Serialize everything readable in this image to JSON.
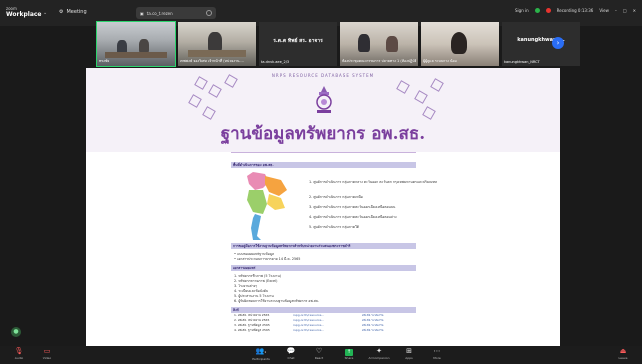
{
  "app": {
    "name_line1": "zoom",
    "name_line2": "Workplace",
    "meeting_label": "Meeting",
    "sharing_label": "ta.co_t.rezen"
  },
  "status": {
    "signin": "Sign in",
    "recording": "Recording 0:13:36",
    "view": "View",
    "rec_color": "#e8342f",
    "ok_color": "#2bb34a"
  },
  "participants": [
    {
      "caption": "ทรงชัย",
      "center": ""
    },
    {
      "caption": "เทพพงษ์ จองวิเศษ เจ้าหน้าที่ (หน่วยงาน....",
      "center": ""
    },
    {
      "caption": "ta.dnvk.aee_2/3",
      "center": "ร.ต.ต ทิพย์ สร. อาจาร"
    },
    {
      "caption": "ห้องประชุมคณะกรรมการ ปลายทาง 1 (ห้องปฏิบัติ...",
      "center": ""
    },
    {
      "caption": "ผู้ผู้ดูแล ระบบกาง น้อม",
      "center": ""
    },
    {
      "caption": "kanungkhwan_NRCT",
      "center": "kanungkhwan_..."
    }
  ],
  "document": {
    "system_title": "NRPS RESOURCE DATABASE SYSTEM",
    "main_title": "ฐานข้อมูลทรัพยากร อพ.สธ.",
    "section_area": "พื้นที่ดำเนินการของ อพ.สธ.",
    "regions": [
      "1. ศูนย์การดำเนินการ กลุ่มภาคกลาง ตะวันออก ตะวันตก กรุงเทพมหานครและปริมณฑล",
      "2. ศูนย์การดำเนินการ กลุ่มภาคเหนือ",
      "3. ศูนย์การดำเนินการ กลุ่มภาคตะวันออกเฉียงเหนือตอนบน",
      "4. ศูนย์การดำเนินการ กลุ่มภาคตะวันออกเฉียงเหนือตอนล่าง",
      "5. ศูนย์การดำเนินการ กลุ่มภาคใต้"
    ],
    "section_manual": "การขอคู่มือการใช้งานฐานข้อมูลทรัพยากรสำหรับหน่วยงานร่วมสนองพระราชดำริ",
    "manual_items": [
      "• แบบขอเผยแพร่ฐานข้อมูล",
      "• เอกสารประกอบการบรรยาย 14 มี.ค. 2565"
    ],
    "section_docs": "เอกสารเผยแพร่",
    "doc_items": [
      "1. ทรัพยากรชีวภาพ (5 โรงงาน)",
      "2. ทรัพยากรกายภาพ (Excel)",
      "3. โรงงานต่างๆ",
      "4. ระเบียบและข้อบังคับ",
      "5. ผู้ประสานงาน 5 โรงงาน",
      "6. ผู้รับผิดชอบการใช้งานระบบฐานข้อมูลทรัพยากร อพ.สธ."
    ],
    "section_links": "ลิงก์",
    "links": [
      {
        "label": "1. อพ.สธ. หน่วยงาน 2565",
        "a": "rspg.or.th/resource...",
        "b": "อพ.สธ.ระบบงาน"
      },
      {
        "label": "2. อพ.สธ. หน่วยงาน 2565",
        "a": "rspg.or.th/resource...",
        "b": "อพ.สธ.ระบบงาน"
      },
      {
        "label": "3. อพ.สธ. ฐานข้อมูล 2565",
        "a": "rspg.or.th/resource...",
        "b": "อพ.สธ.ระบบงาน"
      },
      {
        "label": "4. อพ.สธ. ฐานข้อมูล 2565",
        "a": "rspg.or.th/resource...",
        "b": "อพ.สธ.ระบบงาน"
      }
    ],
    "title_color": "#7b3f9e"
  },
  "toolbar": {
    "audio": "Audio",
    "video": "Video",
    "participants": "Participants",
    "participants_count": "1",
    "chat": "Chat",
    "react": "React",
    "share": "Share",
    "ai_companion": "AI Companion",
    "apps": "Apps",
    "more": "More",
    "leave": "Leave"
  }
}
